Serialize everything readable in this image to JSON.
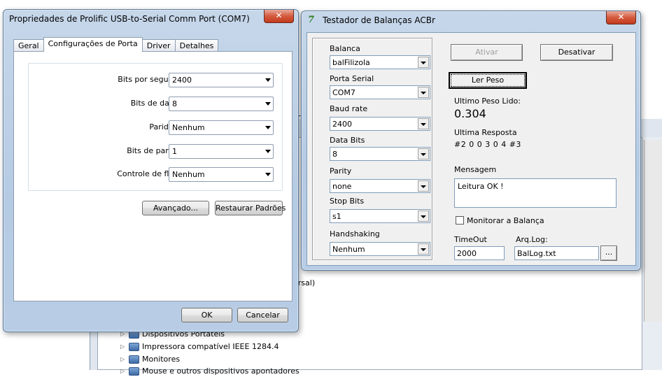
{
  "background": {
    "snippets": {
      "r_text": "r",
      "ersal_text": "ersal)"
    },
    "tree_items": [
      "Dispositivos Portáteis",
      "Impressora compatível IEEE 1284.4",
      "Monitores",
      "Mouse e outros dispositivos apontadores"
    ]
  },
  "props_window": {
    "title": "Propriedades de Prolific USB-to-Serial Comm Port (COM7)",
    "close_glyph": "✕",
    "tabs": [
      "Geral",
      "Configurações de Porta",
      "Driver",
      "Detalhes"
    ],
    "active_tab": "Configurações de Porta",
    "fields": [
      {
        "label": "Bits por segundo:",
        "value": "2400"
      },
      {
        "label": "Bits de dados:",
        "value": "8"
      },
      {
        "label": "Paridade:",
        "value": "Nenhum"
      },
      {
        "label": "Bits de parada:",
        "value": "1"
      },
      {
        "label": "Controle de fluxo:",
        "value": "Nenhum"
      }
    ],
    "advanced_button": "Avançado...",
    "restore_button": "Restaurar Padrões",
    "ok_button": "OK",
    "cancel_button": "Cancelar"
  },
  "acbr_window": {
    "logo_text": "7",
    "title": "Testador de Balanças ACBr",
    "close_glyph": "✕",
    "fields": [
      {
        "label": "Balanca",
        "value": "balFilizola"
      },
      {
        "label": "Porta Serial",
        "value": "COM7"
      },
      {
        "label": "Baud rate",
        "value": "2400"
      },
      {
        "label": "Data Bits",
        "value": "8"
      },
      {
        "label": "Parity",
        "value": "none"
      },
      {
        "label": "Stop Bits",
        "value": "s1"
      },
      {
        "label": "Handshaking",
        "value": "Nenhum"
      }
    ],
    "activate_button": "Ativar",
    "deactivate_button": "Desativar",
    "read_weight_button": "Ler Peso",
    "last_weight_label": "Ultimo Peso Lido:",
    "last_weight_value": "0.304",
    "last_response_label": "Ultima Resposta",
    "last_response_value": "#2 0 0 3 0 4 #3",
    "message_label": "Mensagem",
    "message_value": "Leitura OK !",
    "monitor_checkbox_label": "Monitorar a Balança",
    "monitor_checked": false,
    "timeout_label": "TimeOut",
    "timeout_value": "2000",
    "log_label": "Arq.Log:",
    "log_value": "BalLog.txt",
    "browse_button": "..."
  }
}
